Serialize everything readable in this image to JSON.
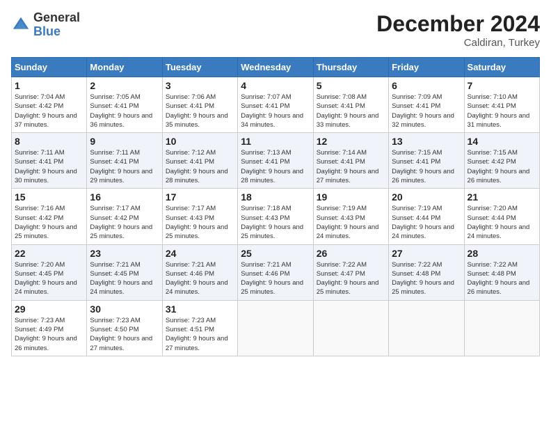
{
  "header": {
    "logo_line1": "General",
    "logo_line2": "Blue",
    "month": "December 2024",
    "location": "Caldiran, Turkey"
  },
  "weekdays": [
    "Sunday",
    "Monday",
    "Tuesday",
    "Wednesday",
    "Thursday",
    "Friday",
    "Saturday"
  ],
  "weeks": [
    [
      {
        "day": "1",
        "sunrise": "Sunrise: 7:04 AM",
        "sunset": "Sunset: 4:42 PM",
        "daylight": "Daylight: 9 hours and 37 minutes."
      },
      {
        "day": "2",
        "sunrise": "Sunrise: 7:05 AM",
        "sunset": "Sunset: 4:41 PM",
        "daylight": "Daylight: 9 hours and 36 minutes."
      },
      {
        "day": "3",
        "sunrise": "Sunrise: 7:06 AM",
        "sunset": "Sunset: 4:41 PM",
        "daylight": "Daylight: 9 hours and 35 minutes."
      },
      {
        "day": "4",
        "sunrise": "Sunrise: 7:07 AM",
        "sunset": "Sunset: 4:41 PM",
        "daylight": "Daylight: 9 hours and 34 minutes."
      },
      {
        "day": "5",
        "sunrise": "Sunrise: 7:08 AM",
        "sunset": "Sunset: 4:41 PM",
        "daylight": "Daylight: 9 hours and 33 minutes."
      },
      {
        "day": "6",
        "sunrise": "Sunrise: 7:09 AM",
        "sunset": "Sunset: 4:41 PM",
        "daylight": "Daylight: 9 hours and 32 minutes."
      },
      {
        "day": "7",
        "sunrise": "Sunrise: 7:10 AM",
        "sunset": "Sunset: 4:41 PM",
        "daylight": "Daylight: 9 hours and 31 minutes."
      }
    ],
    [
      {
        "day": "8",
        "sunrise": "Sunrise: 7:11 AM",
        "sunset": "Sunset: 4:41 PM",
        "daylight": "Daylight: 9 hours and 30 minutes."
      },
      {
        "day": "9",
        "sunrise": "Sunrise: 7:11 AM",
        "sunset": "Sunset: 4:41 PM",
        "daylight": "Daylight: 9 hours and 29 minutes."
      },
      {
        "day": "10",
        "sunrise": "Sunrise: 7:12 AM",
        "sunset": "Sunset: 4:41 PM",
        "daylight": "Daylight: 9 hours and 28 minutes."
      },
      {
        "day": "11",
        "sunrise": "Sunrise: 7:13 AM",
        "sunset": "Sunset: 4:41 PM",
        "daylight": "Daylight: 9 hours and 28 minutes."
      },
      {
        "day": "12",
        "sunrise": "Sunrise: 7:14 AM",
        "sunset": "Sunset: 4:41 PM",
        "daylight": "Daylight: 9 hours and 27 minutes."
      },
      {
        "day": "13",
        "sunrise": "Sunrise: 7:15 AM",
        "sunset": "Sunset: 4:41 PM",
        "daylight": "Daylight: 9 hours and 26 minutes."
      },
      {
        "day": "14",
        "sunrise": "Sunrise: 7:15 AM",
        "sunset": "Sunset: 4:42 PM",
        "daylight": "Daylight: 9 hours and 26 minutes."
      }
    ],
    [
      {
        "day": "15",
        "sunrise": "Sunrise: 7:16 AM",
        "sunset": "Sunset: 4:42 PM",
        "daylight": "Daylight: 9 hours and 25 minutes."
      },
      {
        "day": "16",
        "sunrise": "Sunrise: 7:17 AM",
        "sunset": "Sunset: 4:42 PM",
        "daylight": "Daylight: 9 hours and 25 minutes."
      },
      {
        "day": "17",
        "sunrise": "Sunrise: 7:17 AM",
        "sunset": "Sunset: 4:43 PM",
        "daylight": "Daylight: 9 hours and 25 minutes."
      },
      {
        "day": "18",
        "sunrise": "Sunrise: 7:18 AM",
        "sunset": "Sunset: 4:43 PM",
        "daylight": "Daylight: 9 hours and 25 minutes."
      },
      {
        "day": "19",
        "sunrise": "Sunrise: 7:19 AM",
        "sunset": "Sunset: 4:43 PM",
        "daylight": "Daylight: 9 hours and 24 minutes."
      },
      {
        "day": "20",
        "sunrise": "Sunrise: 7:19 AM",
        "sunset": "Sunset: 4:44 PM",
        "daylight": "Daylight: 9 hours and 24 minutes."
      },
      {
        "day": "21",
        "sunrise": "Sunrise: 7:20 AM",
        "sunset": "Sunset: 4:44 PM",
        "daylight": "Daylight: 9 hours and 24 minutes."
      }
    ],
    [
      {
        "day": "22",
        "sunrise": "Sunrise: 7:20 AM",
        "sunset": "Sunset: 4:45 PM",
        "daylight": "Daylight: 9 hours and 24 minutes."
      },
      {
        "day": "23",
        "sunrise": "Sunrise: 7:21 AM",
        "sunset": "Sunset: 4:45 PM",
        "daylight": "Daylight: 9 hours and 24 minutes."
      },
      {
        "day": "24",
        "sunrise": "Sunrise: 7:21 AM",
        "sunset": "Sunset: 4:46 PM",
        "daylight": "Daylight: 9 hours and 24 minutes."
      },
      {
        "day": "25",
        "sunrise": "Sunrise: 7:21 AM",
        "sunset": "Sunset: 4:46 PM",
        "daylight": "Daylight: 9 hours and 25 minutes."
      },
      {
        "day": "26",
        "sunrise": "Sunrise: 7:22 AM",
        "sunset": "Sunset: 4:47 PM",
        "daylight": "Daylight: 9 hours and 25 minutes."
      },
      {
        "day": "27",
        "sunrise": "Sunrise: 7:22 AM",
        "sunset": "Sunset: 4:48 PM",
        "daylight": "Daylight: 9 hours and 25 minutes."
      },
      {
        "day": "28",
        "sunrise": "Sunrise: 7:22 AM",
        "sunset": "Sunset: 4:48 PM",
        "daylight": "Daylight: 9 hours and 26 minutes."
      }
    ],
    [
      {
        "day": "29",
        "sunrise": "Sunrise: 7:23 AM",
        "sunset": "Sunset: 4:49 PM",
        "daylight": "Daylight: 9 hours and 26 minutes."
      },
      {
        "day": "30",
        "sunrise": "Sunrise: 7:23 AM",
        "sunset": "Sunset: 4:50 PM",
        "daylight": "Daylight: 9 hours and 27 minutes."
      },
      {
        "day": "31",
        "sunrise": "Sunrise: 7:23 AM",
        "sunset": "Sunset: 4:51 PM",
        "daylight": "Daylight: 9 hours and 27 minutes."
      },
      null,
      null,
      null,
      null
    ]
  ]
}
